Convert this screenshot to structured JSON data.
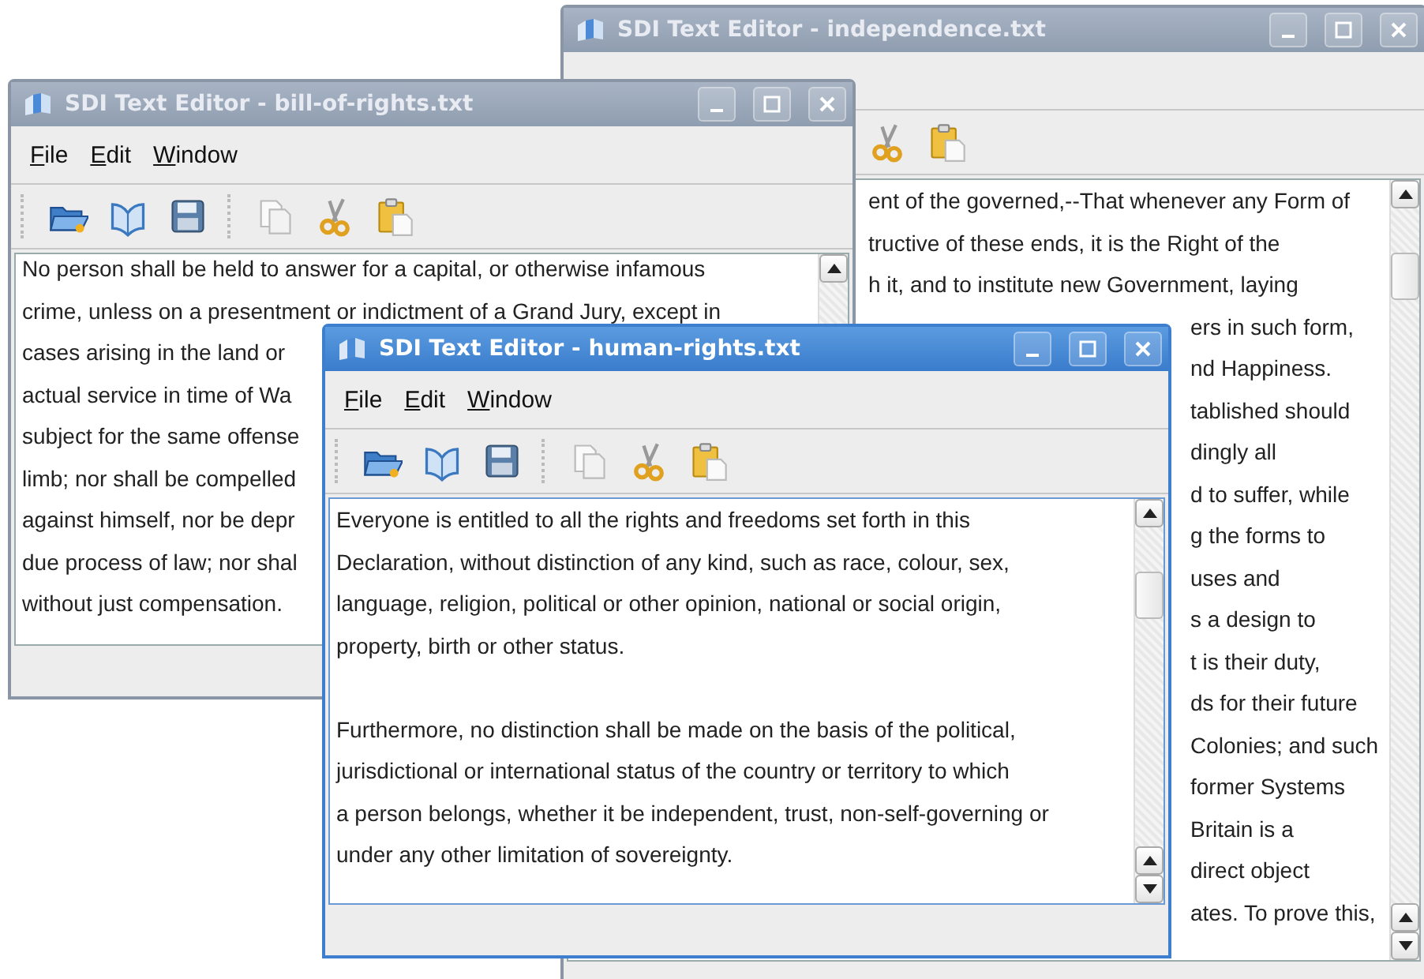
{
  "windows": [
    {
      "title": "SDI Text Editor - independence.txt",
      "active": false,
      "paragraphs": [
        [
          "ent of the governed,--That whenever any Form of",
          "tructive of these ends, it is the Right of the",
          "h it, and to institute new Government, laying",
          "ers in such form,",
          "nd Happiness.",
          "tablished should",
          "dingly all",
          "d to suffer, while",
          "g the forms to",
          "uses and",
          "s a design to",
          "t is their duty,",
          "ds for their future",
          "Colonies; and such",
          "former Systems",
          "Britain is a",
          "direct object",
          "ates. To prove this,"
        ]
      ]
    },
    {
      "title": "SDI Text Editor - bill-of-rights.txt",
      "active": false,
      "menu": [
        "File",
        "Edit",
        "Window"
      ],
      "paragraphs": [
        [
          "No person shall be held to answer for a capital, or otherwise infamous",
          "crime, unless on a presentment or indictment of a Grand Jury, except in",
          "cases arising in the land or",
          "actual service in time of Wa",
          "subject for the same offense",
          "limb; nor shall be compelled",
          "against himself, nor be depr",
          "due process of law; nor shal",
          "without just compensation."
        ]
      ]
    },
    {
      "title": "SDI Text Editor - human-rights.txt",
      "active": true,
      "menu": [
        "File",
        "Edit",
        "Window"
      ],
      "paragraphs": [
        [
          "Everyone is entitled to all the rights and freedoms set forth in this",
          "Declaration, without distinction of any kind, such as race, colour, sex,",
          "language, religion, political or other opinion, national or social origin,",
          "property, birth or other status."
        ],
        [
          "Furthermore, no distinction shall be made on the basis of the political,",
          "jurisdictional or international status of the country or territory to which",
          "a person belongs, whether it be independent, trust, non-self-governing or",
          "under any other limitation of sovereignty."
        ]
      ]
    }
  ]
}
